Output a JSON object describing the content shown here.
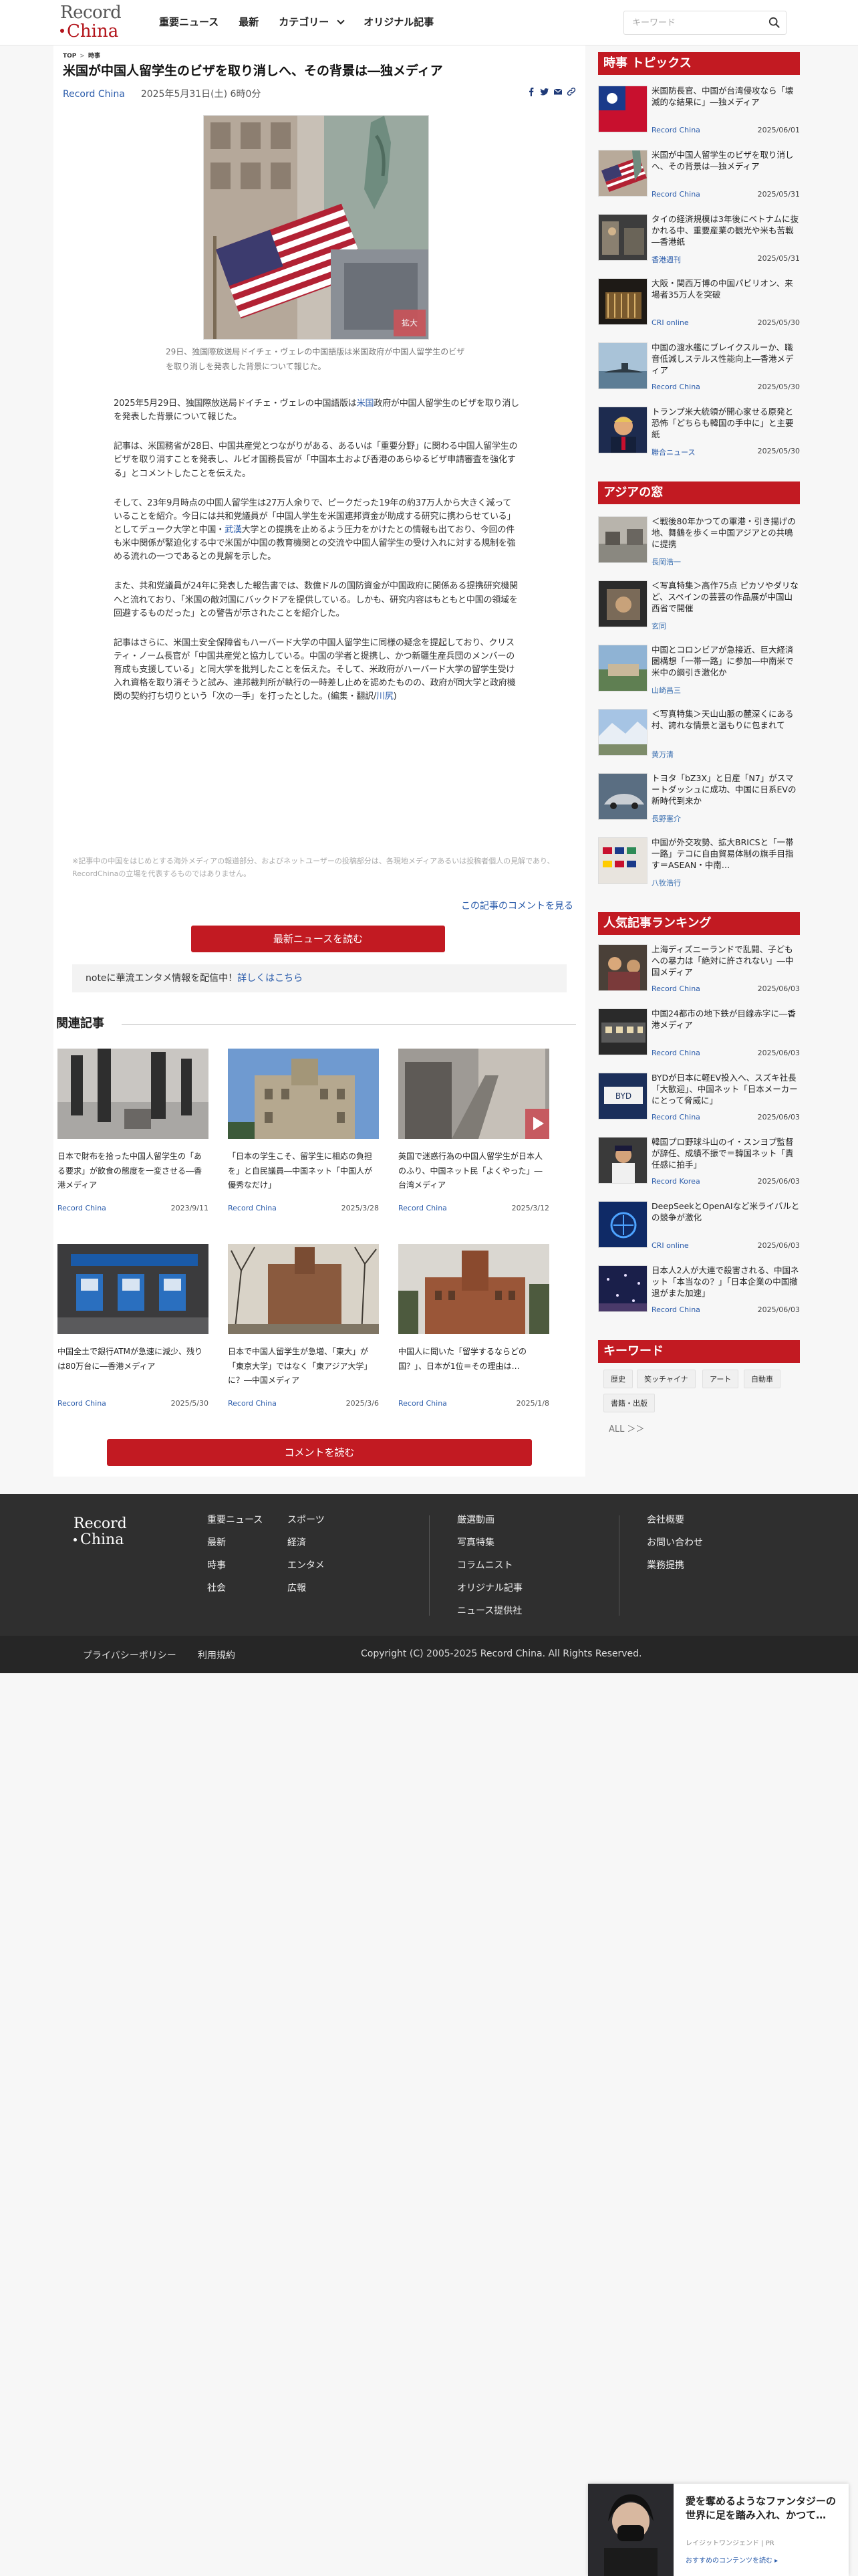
{
  "header": {
    "logo_line1": "Record",
    "logo_line2": "China",
    "nav": [
      "重要ニュース",
      "最新",
      "カテゴリー",
      "オリジナル記事"
    ],
    "search_placeholder": "キーワード"
  },
  "article": {
    "breadcrumb": [
      "TOP",
      "時事"
    ],
    "title": "米国が中国人留学生のビザを取り消しへ、その背景は―独メディア",
    "source": "Record China",
    "date": "2025年5月31日(土) 6時0分",
    "zoom_label": "拡大",
    "caption": "29日、独国際放送局ドイチェ・ヴェレの中国語版は米国政府が中国人留学生のビザを取り消しを発表した背景について報じた。",
    "paragraphs": [
      [
        {
          "t": "2025年5月29日、独国際放送局ドイチェ・ヴェレの中国語版は"
        },
        {
          "t": "米国",
          "link": true
        },
        {
          "t": "政府が中国人留学生のビザを取り消しを発表した背景について報じた。"
        }
      ],
      [
        {
          "t": "記事は、米国務省が28日、中国共産党とつながりがある、あるいは「重要分野」に関わる中国人留学生のビザを取り消すことを発表し、ルビオ国務長官が「中国本土および香港のあらゆるビザ申請審査を強化する」とコメントしたことを伝えた。"
        }
      ],
      [
        {
          "t": "そして、23年9月時点の中国人留学生は27万人余りで、ピークだった19年の約37万人から大きく減っていることを紹介。今日には共和党議員が「中国人学生を米国連邦資金が助成する研究に携わらせている」としてデューク大学と中国・"
        },
        {
          "t": "武漢",
          "link": true
        },
        {
          "t": "大学との提携を止めるよう圧力をかけたとの情報も出ており、今回の件も米中関係が緊迫化する中で米国が中国の教育機関との交流や中国人留学生の受け入れに対する規制を強める流れの一つであるとの見解を示した。"
        }
      ],
      [
        {
          "t": "また、共和党議員が24年に発表した報告書では、数億ドルの国防資金が中国政府に関係ある提携研究機関へと流れており、「米国の敵対国にバックドアを提供している。しかも、研究内容はもともと中国の領域を回避するものだった」との警告が示されたことを紹介した。"
        }
      ],
      [
        {
          "t": "記事はさらに、米国土安全保障省もハーバード大学の中国人留学生に同様の疑念を提起しており、クリスティ・ノーム長官が「中国共産党と協力している。中国の学者と提携し、かつ新疆生産兵団のメンバーの育成も支援している」と同大学を批判したことを伝えた。そして、米政府がハーバード大学の留学生受け入れ資格を取り消そうと試み、連邦裁判所が執行の一時差し止めを認めたものの、政府が同大学と政府機関の契約打ち切りという「次の一手」を打ったとした。(編集・翻訳/"
        },
        {
          "t": "川尻",
          "link": true
        },
        {
          "t": ")"
        }
      ]
    ],
    "notice": "※記事中の中国をはじめとする海外メディアの報道部分、およびネットユーザーの投稿部分は、各現地メディアあるいは投稿者個人の見解であり、RecordChinaの立場を代表するものではありません。",
    "comment_link": "この記事のコメントを見る",
    "latest_button": "最新ニュースを読む",
    "note_text": "noteに華流エンタメ情報を配信中！",
    "note_link": "詳しくはこちら"
  },
  "related": {
    "title": "関連記事",
    "items": [
      {
        "title": "日本で財布を拾った中国人留学生の「ある要求」が飲食の態度を一変させる―香港メディア",
        "source": "Record China",
        "date": "2023/9/11",
        "scene": "street"
      },
      {
        "title": "「日本の学生こそ、留学生に相応の負担を」と自民議員―中国ネット「中国人が優秀なだけ」",
        "source": "Record China",
        "date": "2025/3/28",
        "scene": "building"
      },
      {
        "title": "英国で迷惑行為の中国人留学生が日本人のふり、中国ネット民「よくやった」―台湾メディア",
        "source": "Record China",
        "date": "2025/3/12",
        "scene": "video"
      },
      {
        "title": "中国全土で銀行ATMが急速に減少、残りは80万台に―香港メディア",
        "source": "Record China",
        "date": "2025/5/30",
        "scene": "atm"
      },
      {
        "title": "日本で中国人留学生が急増、「東大」が「東京大学」ではなく「東アジア大学」に？―中国メディア",
        "source": "Record China",
        "date": "2025/3/6",
        "scene": "campus"
      },
      {
        "title": "中国人に聞いた「留学するならどの国？」、日本が1位＝その理由は…",
        "source": "Record China",
        "date": "2025/1/8",
        "scene": "tower"
      }
    ],
    "comment_button": "コメントを読む"
  },
  "sidebar": {
    "topics_title": "時事 トピックス",
    "topics": [
      {
        "title": "米国防長官、中国が台湾侵攻なら「壊滅的な結果に」―独メディア",
        "source": "Record China",
        "date": "2025/06/01"
      },
      {
        "title": "米国が中国人留学生のビザを取り消しへ、その背景は―独メディア",
        "source": "Record China",
        "date": "2025/05/31"
      },
      {
        "title": "タイの経済規模は3年後にベトナムに抜かれる中、重要産業の観光や米も苦戦―香港紙",
        "source": "香港週刊",
        "date": "2025/05/31"
      },
      {
        "title": "大阪・関西万博の中国パビリオン、来場者35万人を突破",
        "source": "CRI online",
        "date": "2025/05/30"
      },
      {
        "title": "中国の渡水艦にブレイクスルーか、職音低減しステルス性能向上―香港メディア",
        "source": "Record China",
        "date": "2025/05/30"
      },
      {
        "title": "トランプ米大統領が開心家せる原発と恐怖「どちらも韓国の手中に」と主要紙",
        "source": "聯合ニュース",
        "date": "2025/05/30"
      }
    ],
    "asia_title": "アジアの窓",
    "asia": [
      {
        "title": "＜戦後80年かつての軍港・引き揚げの地、舞鶴を歩く＝中国アジアとの共鳴に提携",
        "source": "長岡浩一"
      },
      {
        "title": "＜写真特集＞高作75点 ピカソやダリなど、スペインの芸芸の作品展が中国山西省で開催",
        "source": "玄同"
      },
      {
        "title": "中国とコロンビアが急接近、巨大経済圏構想「一帯一路」に参加―中南米で米中の綱引き激化か",
        "source": "山崎昌三"
      },
      {
        "title": "＜写真特集＞天山山脈の麓深くにある村、誇れな情景と温もりに包まれて",
        "source": "黄万清"
      },
      {
        "title": "トヨタ「bZ3X」と日産「N7」がスマートダッシュに成功、中国に日系EVの新時代到来か",
        "source": "長野憲介"
      },
      {
        "title": "中国が外交攻勢、拡大BRICSと「一帯一路」テコに自由貿易体制の旗手目指す＝ASEAN・中南…",
        "source": "八牧浩行"
      }
    ],
    "rank_title": "人気記事ランキング",
    "rank": [
      {
        "title": "上海ディズニーランドで乱闘、子どもへの暴力は「絶対に許されない」―中国メディア",
        "source": "Record China",
        "date": "2025/06/03"
      },
      {
        "title": "中国24都市の地下鉄が目線赤字に―香港メディア",
        "source": "Record China",
        "date": "2025/06/03"
      },
      {
        "title": "BYDが日本に軽EV投入へ、スズキ社長「大歓迎」、中国ネット「日本メーカーにとって脅威に」",
        "source": "Record China",
        "date": "2025/06/03"
      },
      {
        "title": "韓国プロ野球斗山のイ・スンヨプ監督が辞任、成績不振で＝韓国ネット「責任感に拍手」",
        "source": "Record Korea",
        "date": "2025/06/03"
      },
      {
        "title": "DeepSeekとOpenAIなど米ライバルとの競争が激化",
        "source": "CRI online",
        "date": "2025/06/03"
      },
      {
        "title": "日本人2人が大連で殺害される、中国ネット「本当なの？」「日本企業の中国撤退がまた加速」",
        "source": "Record China",
        "date": "2025/06/03"
      }
    ],
    "kw_title": "キーワード",
    "keywords": [
      "歴史",
      "笑ッチャイナ",
      "アート",
      "自動車",
      "書籍・出版"
    ],
    "kw_all": "ALL ＞＞"
  },
  "footer": {
    "logo_line1": "Record",
    "logo_line2": "China",
    "col1": [
      "重要ニュース",
      "最新",
      "時事",
      "社会"
    ],
    "col2": [
      "スポーツ",
      "経済",
      "エンタメ",
      "広報"
    ],
    "col3": [
      "厳選動画",
      "写真特集",
      "コラムニスト",
      "オリジナル記事",
      "ニュース提供社"
    ],
    "col4": [
      "会社概要",
      "お問い合わせ",
      "業務提携"
    ],
    "privacy": "プライバシーポリシー",
    "terms": "利用規約",
    "copyright": "Copyright (C) 2005-2025 Record China. All Rights Reserved."
  },
  "ad": {
    "title": "愛を奪めるようなファンタジーの世界に足を踏み入れ、かつて…",
    "sponsor": "レイジットワンジェンド | PR",
    "link": "おすすめのコンテンツを読む ▸"
  }
}
